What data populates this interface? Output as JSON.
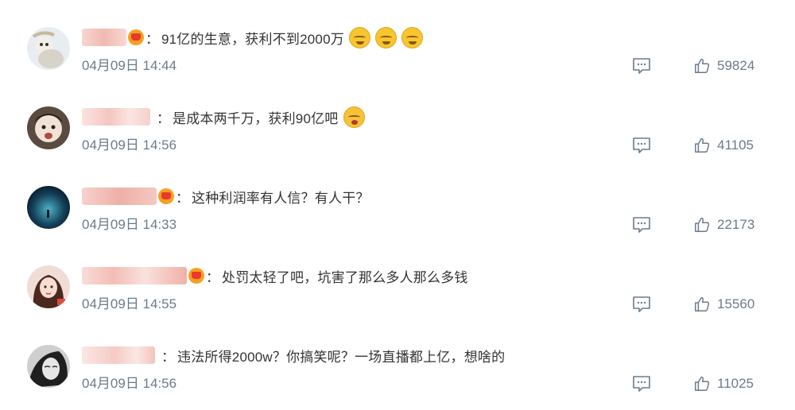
{
  "comments": [
    {
      "username": "",
      "has_vip_badge": true,
      "text": "91亿的生意，获利不到2000万",
      "emojis": [
        "smirk-emoji",
        "smirk-emoji",
        "smirk-emoji"
      ],
      "time": "04月09日 14:44",
      "likes": "59824"
    },
    {
      "username": "",
      "has_vip_badge": false,
      "text": "是成本两千万，获利90亿吧",
      "emojis": [
        "crying-emoji"
      ],
      "time": "04月09日 14:56",
      "likes": "41105"
    },
    {
      "username": "",
      "has_vip_badge": true,
      "text": "这种利润率有人信？有人干？",
      "emojis": [],
      "time": "04月09日 14:33",
      "likes": "22173"
    },
    {
      "username": "",
      "has_vip_badge": true,
      "text": "处罚太轻了吧，坑害了那么多人那么多钱",
      "emojis": [],
      "time": "04月09日 14:55",
      "likes": "15560"
    },
    {
      "username": "",
      "has_vip_badge": false,
      "text": "违法所得2000w？你搞笑呢？一场直播都上亿，想啥的",
      "emojis": [],
      "time": "04月09日 14:56",
      "likes": "11025"
    }
  ],
  "icons": {
    "comment": "comment-icon",
    "like": "thumbs-up-icon",
    "vip": "vip-crown-badge-icon"
  },
  "colors": {
    "text": "#333333",
    "meta": "#6d7a8a",
    "vip_badge": "#f6a021",
    "username_blur": "#f5c9c3"
  }
}
